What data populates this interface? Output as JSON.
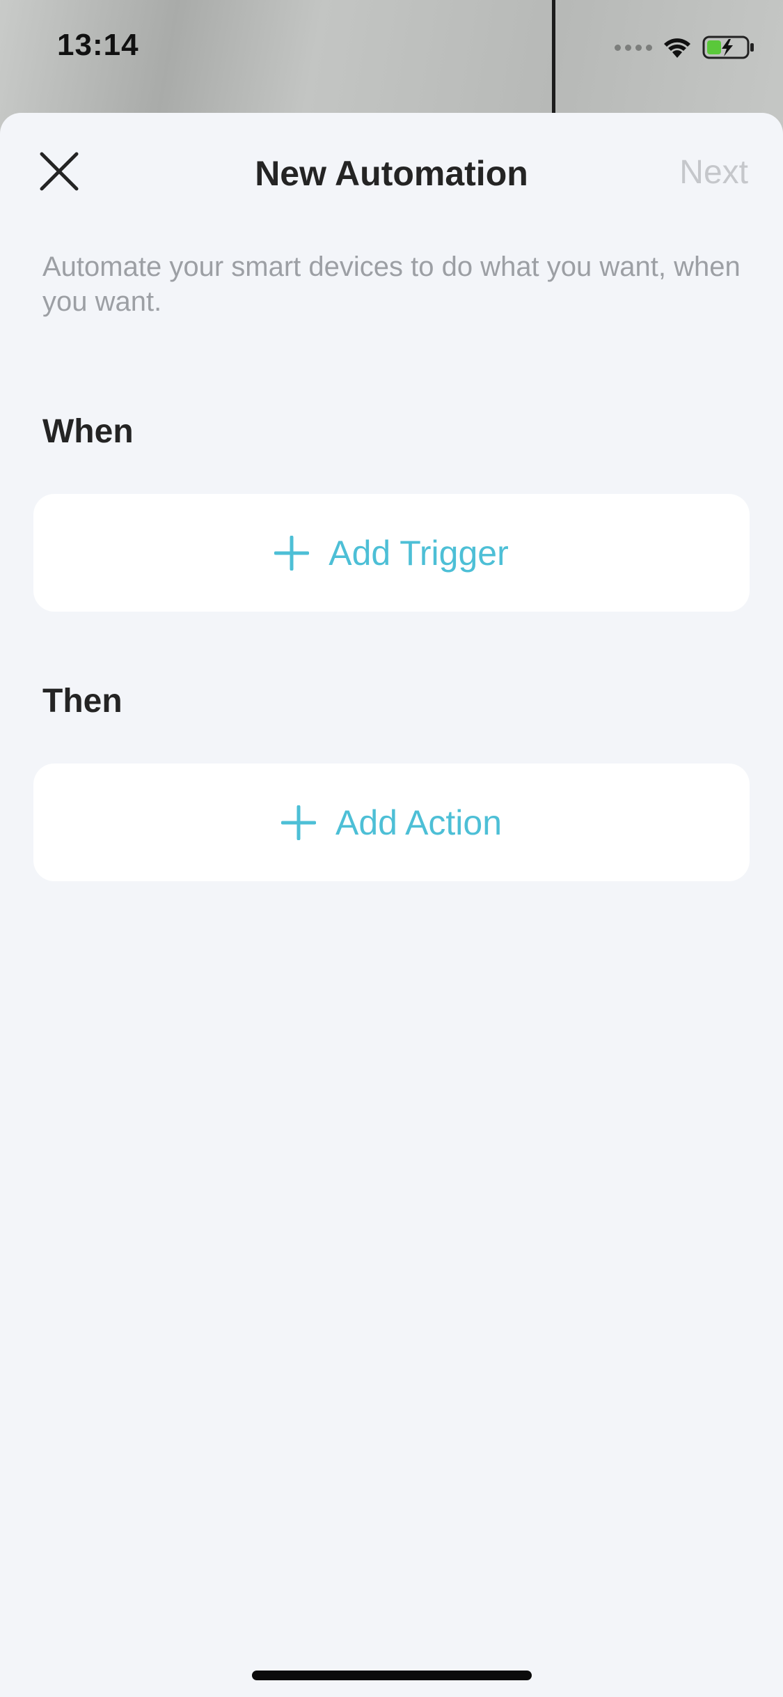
{
  "status_bar": {
    "time": "13:14",
    "icons": [
      "cellular-signal-icon",
      "wifi-icon",
      "battery-charging-icon"
    ]
  },
  "header": {
    "title": "New Automation",
    "close_icon": "close-icon",
    "next_label": "Next"
  },
  "description": "Automate your smart devices to do what you want, when you want.",
  "sections": {
    "when": {
      "title": "When",
      "button_label": "Add Trigger",
      "button_icon": "plus-icon"
    },
    "then": {
      "title": "Then",
      "button_label": "Add Action",
      "button_icon": "plus-icon"
    }
  },
  "colors": {
    "accent": "#4dbfd6",
    "disabled_text": "#c5c7cb",
    "background": "#f3f5f9",
    "card": "#ffffff",
    "battery_green": "#5ac83a"
  }
}
